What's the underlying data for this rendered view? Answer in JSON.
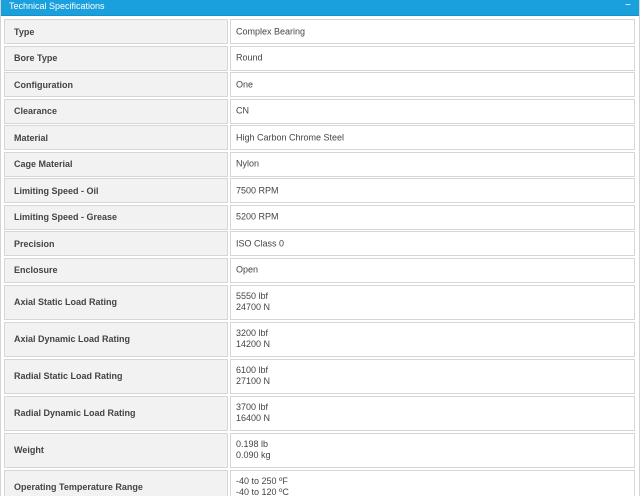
{
  "header": {
    "title": "Technical Specifications",
    "collapse_glyph": "−"
  },
  "specs": [
    {
      "label": "Type",
      "values": [
        "Complex Bearing"
      ]
    },
    {
      "label": "Bore Type",
      "values": [
        "Round"
      ]
    },
    {
      "label": "Configuration",
      "values": [
        "One"
      ]
    },
    {
      "label": "Clearance",
      "values": [
        "CN"
      ]
    },
    {
      "label": "Material",
      "values": [
        "High Carbon Chrome Steel"
      ]
    },
    {
      "label": "Cage Material",
      "values": [
        "Nylon"
      ]
    },
    {
      "label": "Limiting Speed - Oil",
      "values": [
        "7500 RPM"
      ]
    },
    {
      "label": "Limiting Speed - Grease",
      "values": [
        "5200 RPM"
      ]
    },
    {
      "label": "Precision",
      "values": [
        "ISO Class 0"
      ]
    },
    {
      "label": "Enclosure",
      "values": [
        "Open"
      ]
    },
    {
      "label": "Axial Static Load Rating",
      "values": [
        "5550 lbf",
        "24700 N"
      ]
    },
    {
      "label": "Axial Dynamic Load Rating",
      "values": [
        "3200 lbf",
        "14200 N"
      ]
    },
    {
      "label": "Radial Static Load Rating",
      "values": [
        "6100 lbf",
        "27100 N"
      ]
    },
    {
      "label": "Radial Dynamic Load Rating",
      "values": [
        "3700 lbf",
        "16400 N"
      ]
    },
    {
      "label": "Weight",
      "values": [
        "0.198 lb",
        "0.090 kg"
      ]
    },
    {
      "label": "Operating Temperature Range",
      "values": [
        "-40 to 250 ºF",
        "-40 to 120 ºC"
      ]
    }
  ]
}
